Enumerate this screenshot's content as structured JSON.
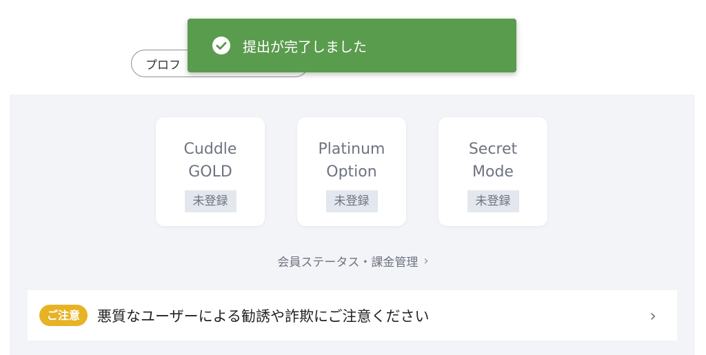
{
  "profile": {
    "button_label": "プロフ"
  },
  "plans": [
    {
      "title": "Cuddle\nGOLD",
      "status": "未登録"
    },
    {
      "title": "Platinum\nOption",
      "status": "未登録"
    },
    {
      "title": "Secret\nMode",
      "status": "未登録"
    }
  ],
  "status_link": {
    "label": "会員ステータス・課金管理",
    "chevron": "›"
  },
  "notice": {
    "badge": "ご注意",
    "text": "悪質なユーザーによる勧誘や詐欺にご注意ください",
    "chevron": "›"
  },
  "toast": {
    "message": "提出が完了しました",
    "icon": "check-circle-icon"
  },
  "colors": {
    "toast_bg": "#5a9c4d",
    "notice_badge": "#e6b325",
    "panel_bg": "#f3f4f8"
  }
}
